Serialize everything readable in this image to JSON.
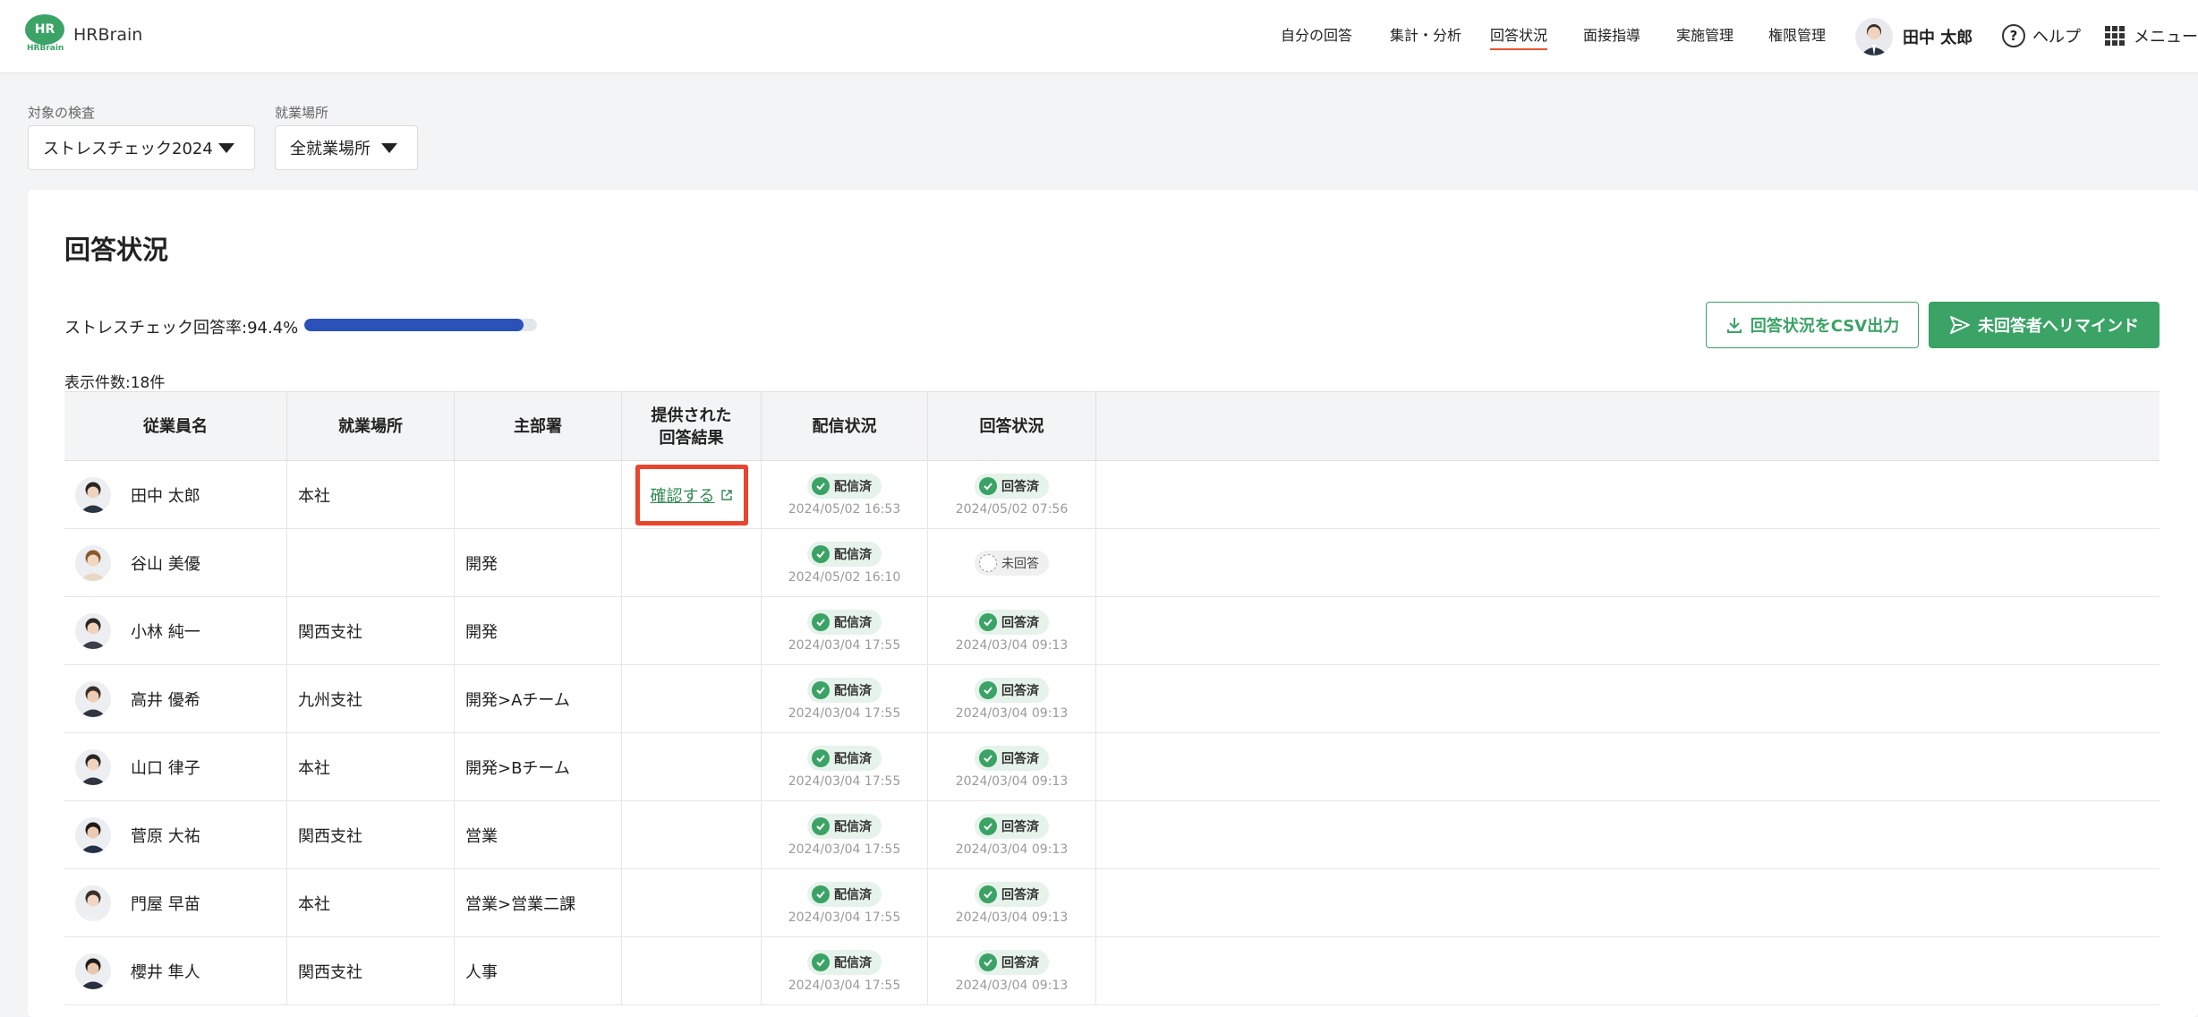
{
  "header": {
    "logo_mark": "HR",
    "logo_sub": "HRBrain",
    "brand": "HRBrain",
    "nav": [
      {
        "label": "自分の回答",
        "active": false
      },
      {
        "label": "集計・分析",
        "active": false
      },
      {
        "label": "回答状況",
        "active": true
      },
      {
        "label": "面接指導",
        "active": false
      },
      {
        "label": "実施管理",
        "active": false
      },
      {
        "label": "権限管理",
        "active": false
      }
    ],
    "user_name": "田中 太郎",
    "help_label": "ヘルプ",
    "menu_label": "メニュー"
  },
  "filters": {
    "survey": {
      "label": "対象の検査",
      "value": "ストレスチェック2024"
    },
    "workplace": {
      "label": "就業場所",
      "value": "全就業場所"
    }
  },
  "main": {
    "title": "回答状況",
    "rate_label": "ストレスチェック回答率:94.4%",
    "rate_value": 0.944,
    "count_label": "表示件数:18件",
    "csv_button": "回答状況をCSV出力",
    "remind_button": "未回答者へリマインド"
  },
  "table": {
    "headers": {
      "name": "従業員名",
      "location": "就業場所",
      "dept": "主部署",
      "result_line1": "提供された",
      "result_line2": "回答結果",
      "delivery": "配信状況",
      "answer": "回答状況"
    },
    "rows": [
      {
        "name": "田中 太郎",
        "location": "本社",
        "dept": "",
        "result": "確認する",
        "delivery": "配信済",
        "delivery_time": "2024/05/02 16:53",
        "answer": "回答済",
        "answer_time": "2024/05/02 07:56",
        "answered": true
      },
      {
        "name": "谷山 美優",
        "location": "",
        "dept": "開発",
        "result": "",
        "delivery": "配信済",
        "delivery_time": "2024/05/02 16:10",
        "answer": "未回答",
        "answer_time": "",
        "answered": false
      },
      {
        "name": "小林 純一",
        "location": "関西支社",
        "dept": "開発",
        "result": "",
        "delivery": "配信済",
        "delivery_time": "2024/03/04 17:55",
        "answer": "回答済",
        "answer_time": "2024/03/04 09:13",
        "answered": true
      },
      {
        "name": "高井 優希",
        "location": "九州支社",
        "dept": "開発>Aチーム",
        "result": "",
        "delivery": "配信済",
        "delivery_time": "2024/03/04 17:55",
        "answer": "回答済",
        "answer_time": "2024/03/04 09:13",
        "answered": true
      },
      {
        "name": "山口 律子",
        "location": "本社",
        "dept": "開発>Bチーム",
        "result": "",
        "delivery": "配信済",
        "delivery_time": "2024/03/04 17:55",
        "answer": "回答済",
        "answer_time": "2024/03/04 09:13",
        "answered": true
      },
      {
        "name": "菅原 大祐",
        "location": "関西支社",
        "dept": "営業",
        "result": "",
        "delivery": "配信済",
        "delivery_time": "2024/03/04 17:55",
        "answer": "回答済",
        "answer_time": "2024/03/04 09:13",
        "answered": true
      },
      {
        "name": "門屋 早苗",
        "location": "本社",
        "dept": "営業>営業二課",
        "result": "",
        "delivery": "配信済",
        "delivery_time": "2024/03/04 17:55",
        "answer": "回答済",
        "answer_time": "2024/03/04 09:13",
        "answered": true
      },
      {
        "name": "櫻井 隼人",
        "location": "関西支社",
        "dept": "人事",
        "result": "",
        "delivery": "配信済",
        "delivery_time": "2024/03/04 17:55",
        "answer": "回答済",
        "answer_time": "2024/03/04 09:13",
        "answered": true
      }
    ]
  },
  "colors": {
    "accent_green": "#3aa365",
    "progress_blue": "#2a52b9",
    "highlight_red": "#e8452f"
  }
}
